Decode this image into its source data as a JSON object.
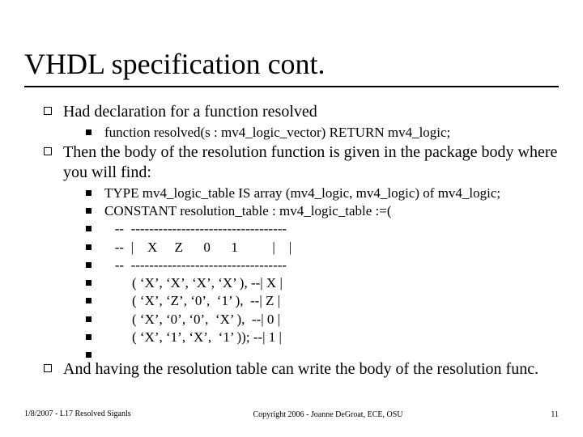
{
  "title": "VHDL specification cont.",
  "bullets": {
    "b1": "Had declaration for a function resolved",
    "b1s1": "function resolved(s : mv4_logic_vector) RETURN mv4_logic;",
    "b2": "Then the body of the resolution function is given in the package body where you will find:",
    "b2s1": "TYPE mv4_logic_table IS array (mv4_logic, mv4_logic) of mv4_logic;",
    "b2s2": "CONSTANT resolution_table : mv4_logic_table :=(",
    "b2s3": "   --  ----------------------------------",
    "b2s4": "   --  |    X     Z      0      1          |    |",
    "b2s5": "   --  ----------------------------------",
    "b2s6": "        ( ‘X’, ‘X’, ‘X’, ‘X’ ), --| X |",
    "b2s7": "        ( ‘X’, ‘Z’, ‘0’,  ‘1’ ),  --| Z |",
    "b2s8": "        ( ‘X’, ‘0’, ‘0’,  ‘X’ ),  --| 0 |",
    "b2s9": "        ( ‘X’, ‘1’, ‘X’,  ‘1’ )); --| 1 |",
    "b2s10": "",
    "b3": "And having the resolution table can write the body of the resolution func."
  },
  "footer": {
    "left": "1/8/2007 - L17 Resolved Siganls",
    "center": "Copyright 2006 - Joanne DeGroat, ECE, OSU",
    "right": "11"
  }
}
